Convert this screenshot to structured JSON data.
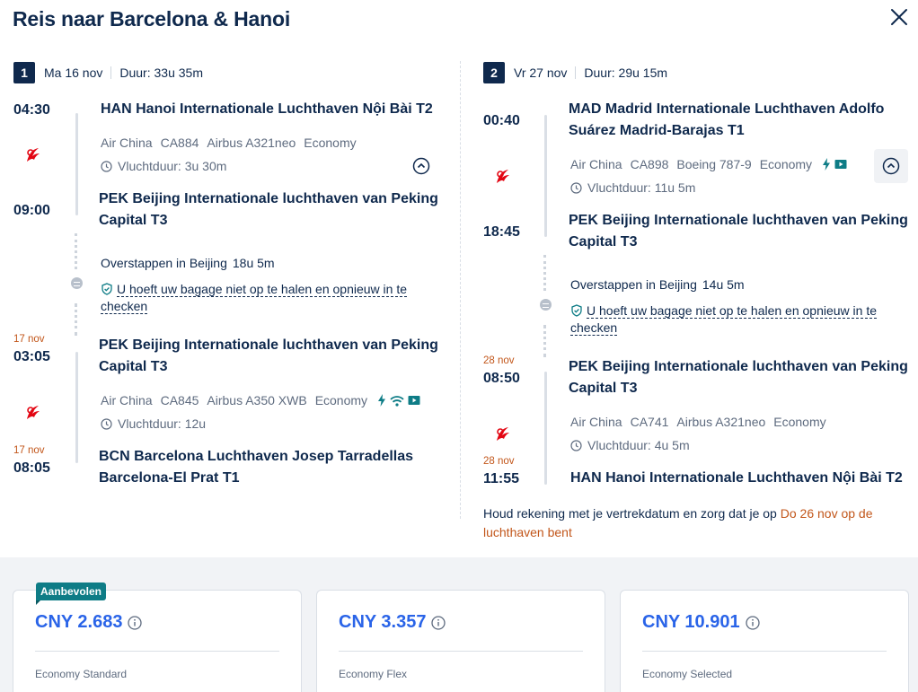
{
  "title": "Reis naar Barcelona & Hanoi",
  "legs": [
    {
      "number": "1",
      "date": "Ma 16 nov",
      "duration": "Duur: 33u 35m",
      "seg1": {
        "dep_time": "04:30",
        "dep_airport": "HAN Hanoi Internationale Luchthaven Nội Bài T2",
        "airline": "Air China",
        "flight": "CA884",
        "aircraft": "Airbus A321neo",
        "cabin": "Economy",
        "flight_duration": "Vluchtduur: 3u 30m",
        "arr_time": "09:00",
        "arr_airport_l1": "PEK Beijing Internationale luchthaven van Peking",
        "arr_airport_l2": "Capital T3"
      },
      "transfer": {
        "label": "Overstappen in Beijing",
        "duration": "18u 5m",
        "baggage_l1": "U hoeft uw bagage niet op te halen en opnieuw in te",
        "baggage_l2": "checken"
      },
      "seg2": {
        "dep_date": "17 nov",
        "dep_time": "03:05",
        "dep_airport_l1": "PEK Beijing Internationale luchthaven van Peking",
        "dep_airport_l2": "Capital T3",
        "airline": "Air China",
        "flight": "CA845",
        "aircraft": "Airbus A350 XWB",
        "cabin": "Economy",
        "flight_duration": "Vluchtduur: 12u",
        "arr_date": "17 nov",
        "arr_time": "08:05",
        "arr_airport_l1": "BCN Barcelona Luchthaven Josep Tarradellas",
        "arr_airport_l2": "Barcelona-El Prat T1"
      }
    },
    {
      "number": "2",
      "date": "Vr 27 nov",
      "duration": "Duur: 29u 15m",
      "seg1": {
        "dep_time": "00:40",
        "dep_airport_l1": "MAD Madrid Internationale Luchthaven Adolfo",
        "dep_airport_l2": "Suárez Madrid-Barajas T1",
        "airline": "Air China",
        "flight": "CA898",
        "aircraft": "Boeing 787-9",
        "cabin": "Economy",
        "flight_duration": "Vluchtduur: 11u 5m",
        "arr_time": "18:45",
        "arr_airport_l1": "PEK Beijing Internationale luchthaven van Peking",
        "arr_airport_l2": "Capital T3"
      },
      "transfer": {
        "label": "Overstappen in Beijing",
        "duration": "14u 5m",
        "baggage_l1": "U hoeft uw bagage niet op te halen en opnieuw in te",
        "baggage_l2": "checken"
      },
      "seg2": {
        "dep_date": "28 nov",
        "dep_time": "08:50",
        "dep_airport_l1": "PEK Beijing Internationale luchthaven van Peking",
        "dep_airport_l2": "Capital T3",
        "airline": "Air China",
        "flight": "CA741",
        "aircraft": "Airbus A321neo",
        "cabin": "Economy",
        "flight_duration": "Vluchtduur: 4u 5m",
        "arr_date": "28 nov",
        "arr_time": "11:55",
        "arr_airport": "HAN Hanoi Internationale Luchthaven Nội Bài T2"
      }
    }
  ],
  "note": {
    "text": "Houd rekening met je vertrekdatum en zorg dat je op ",
    "highlight": "Do 26 nov op de luchthaven bent"
  },
  "fares": [
    {
      "badge": "Aanbevolen",
      "price": "CNY 2.683",
      "name": "Economy Standard"
    },
    {
      "price": "CNY 3.357",
      "name": "Economy Flex"
    },
    {
      "price": "CNY 10.901",
      "name": "Economy Selected"
    }
  ],
  "colors": {
    "primary": "#0f294d",
    "accent_blue": "#2a64e8",
    "accent_orange": "#c2561a",
    "badge_teal": "#0e7c86",
    "air_china_red": "#e30613"
  },
  "icons": {
    "close": "close-icon",
    "clock": "clock-icon",
    "shield": "shield-check-icon",
    "collapse": "chevron-up-circle-icon",
    "power": "power-icon",
    "wifi": "wifi-icon",
    "entertainment": "entertainment-icon",
    "info": "info-icon",
    "airline_logo": "air-china-logo"
  }
}
